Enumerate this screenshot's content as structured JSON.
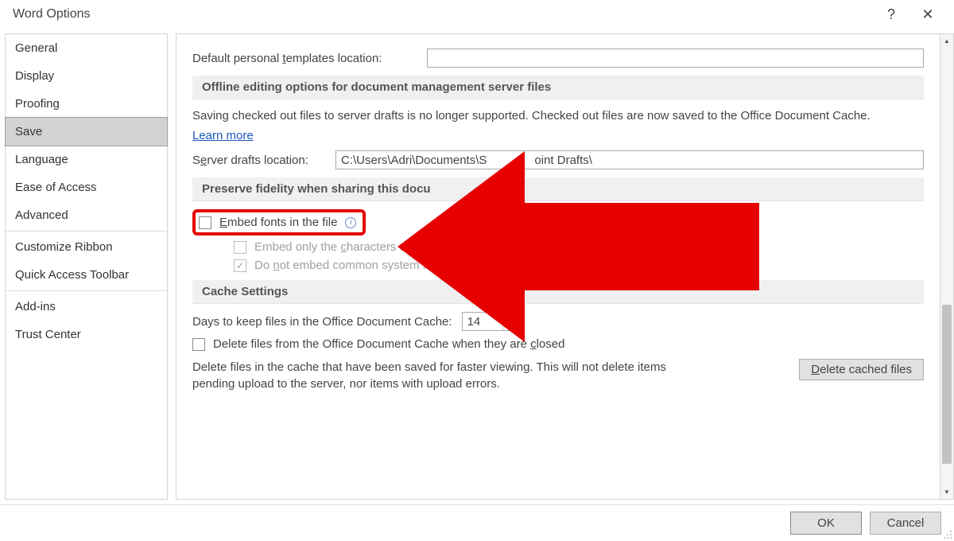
{
  "dialog_title": "Word Options",
  "sidebar": {
    "items": [
      {
        "label": "General"
      },
      {
        "label": "Display"
      },
      {
        "label": "Proofing"
      },
      {
        "label": "Save",
        "selected": true
      },
      {
        "label": "Language"
      },
      {
        "label": "Ease of Access"
      },
      {
        "label": "Advanced"
      },
      {
        "label": "Customize Ribbon",
        "sep_before": true
      },
      {
        "label": "Quick Access Toolbar"
      },
      {
        "label": "Add-ins",
        "sep_before": true
      },
      {
        "label": "Trust Center"
      }
    ]
  },
  "content": {
    "templates_label": "Default personal templates location:",
    "templates_value": "",
    "section_offline": "Offline editing options for document management server files",
    "offline_text": "Saving checked out files to server drafts is no longer supported. Checked out files are now saved to the Office Document Cache.",
    "learn_more": "Learn more",
    "server_drafts_label": "Server drafts location:",
    "server_drafts_value_before": "C:\\Users\\Adri\\Documents\\S",
    "server_drafts_value_after": "oint Drafts\\",
    "section_preserve": "Preserve fidelity when sharing this docu",
    "embed_fonts": "Embed fonts in the file",
    "embed_only_chars": "Embed only the characters used",
    "no_embed_common": "Do not embed common system fonts",
    "section_cache": "Cache Settings",
    "days_label": "Days to keep files in the Office Document Cache:",
    "days_value": "14",
    "delete_closed": "Delete files from the Office Document Cache when they are closed",
    "delete_desc": "Delete files in the cache that have been saved for faster viewing. This will not delete items pending upload to the server, nor items with upload errors.",
    "delete_btn": "Delete cached files"
  },
  "footer": {
    "ok": "OK",
    "cancel": "Cancel"
  }
}
